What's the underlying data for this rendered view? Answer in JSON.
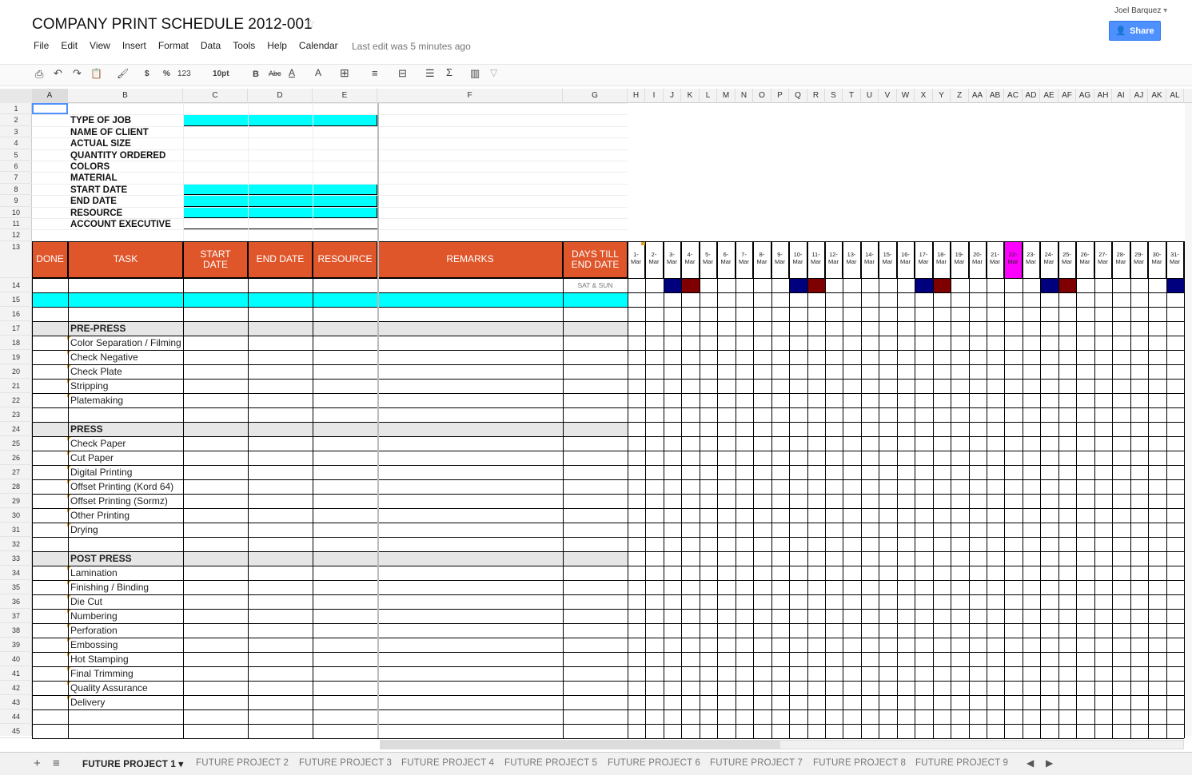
{
  "doc": {
    "title": "COMPANY PRINT SCHEDULE 2012-001",
    "star": "☆",
    "user": "Joel Barquez",
    "share_label": "Share",
    "last_edit": "Last edit was 5 minutes ago"
  },
  "menu": [
    "File",
    "Edit",
    "View",
    "Insert",
    "Format",
    "Data",
    "Tools",
    "Help",
    "Calendar"
  ],
  "toolbar": {
    "currency": "$",
    "percent": "%",
    "number_format": "123",
    "font_size": "10pt",
    "bold": "B",
    "strike": "Abc",
    "text_color": "A",
    "fill": "A",
    "sum": "Σ"
  },
  "columns": [
    "A",
    "B",
    "C",
    "D",
    "E",
    "F",
    "G",
    "H",
    "I",
    "J",
    "K",
    "L",
    "M",
    "N",
    "O",
    "P",
    "Q",
    "R",
    "S",
    "T",
    "U",
    "V",
    "W",
    "X",
    "Y",
    "Z",
    "AA",
    "AB",
    "AC",
    "AD",
    "AE",
    "AF",
    "AG",
    "AH",
    "AI",
    "AJ",
    "AK",
    "AL"
  ],
  "info_labels": [
    "TYPE OF JOB",
    "NAME OF CLIENT",
    "ACTUAL SIZE",
    "QUANTITY ORDERED",
    "COLORS",
    "MATERIAL",
    "START DATE",
    "END DATE",
    "RESOURCE",
    "ACCOUNT EXECUTIVE"
  ],
  "header": {
    "done": "DONE",
    "task": "TASK",
    "start_date": "START DATE",
    "end_date": "END DATE",
    "resource": "RESOURCE",
    "remarks": "REMARKS",
    "days_till": "DAYS TILL END DATE"
  },
  "weekend_label": "SAT & SUN",
  "days": [
    "1-",
    "2-",
    "3-",
    "4-",
    "5-",
    "6-",
    "7-",
    "8-",
    "9-",
    "10-",
    "11-",
    "12-",
    "13-",
    "14-",
    "15-",
    "16-",
    "17-",
    "18-",
    "19-",
    "20-",
    "21-",
    "22-",
    "23-",
    "24-",
    "25-",
    "26-",
    "27-",
    "28-",
    "29-",
    "30-",
    "31-"
  ],
  "month": "Mar",
  "highlight_day": "22-",
  "weekend_colors": {
    "sat": "#00007f",
    "sun": "#7f0000",
    "today": "#ff00ff",
    "header": "#e0562b",
    "cyan": "#00ffff",
    "section": "#e6e6e6"
  },
  "sections": [
    {
      "row": 17,
      "title": "PRE-PRESS",
      "tasks": [
        "Color Separation / Filming",
        "Check Negative",
        "Check Plate",
        "Stripping",
        "Platemaking"
      ]
    },
    {
      "row": 24,
      "title": "PRESS",
      "tasks": [
        "Check Paper",
        "Cut Paper",
        "Digital Printing",
        "Offset Printing (Kord 64)",
        "Offset Printing (Sormz)",
        "Other Printing",
        "Drying"
      ]
    },
    {
      "row": 33,
      "title": "POST PRESS",
      "tasks": [
        "Lamination",
        "Finishing / Binding",
        "Die Cut",
        "Numbering",
        "Perforation",
        "Embossing",
        "Hot Stamping",
        "Final Trimming",
        "Quality Assurance",
        "Delivery"
      ]
    }
  ],
  "tabs": [
    "FUTURE PROJECT 1",
    "FUTURE PROJECT 2",
    "FUTURE PROJECT 3",
    "FUTURE PROJECT 4",
    "FUTURE PROJECT 5",
    "FUTURE PROJECT 6",
    "FUTURE PROJECT 7",
    "FUTURE PROJECT 8",
    "FUTURE PROJECT 9"
  ]
}
